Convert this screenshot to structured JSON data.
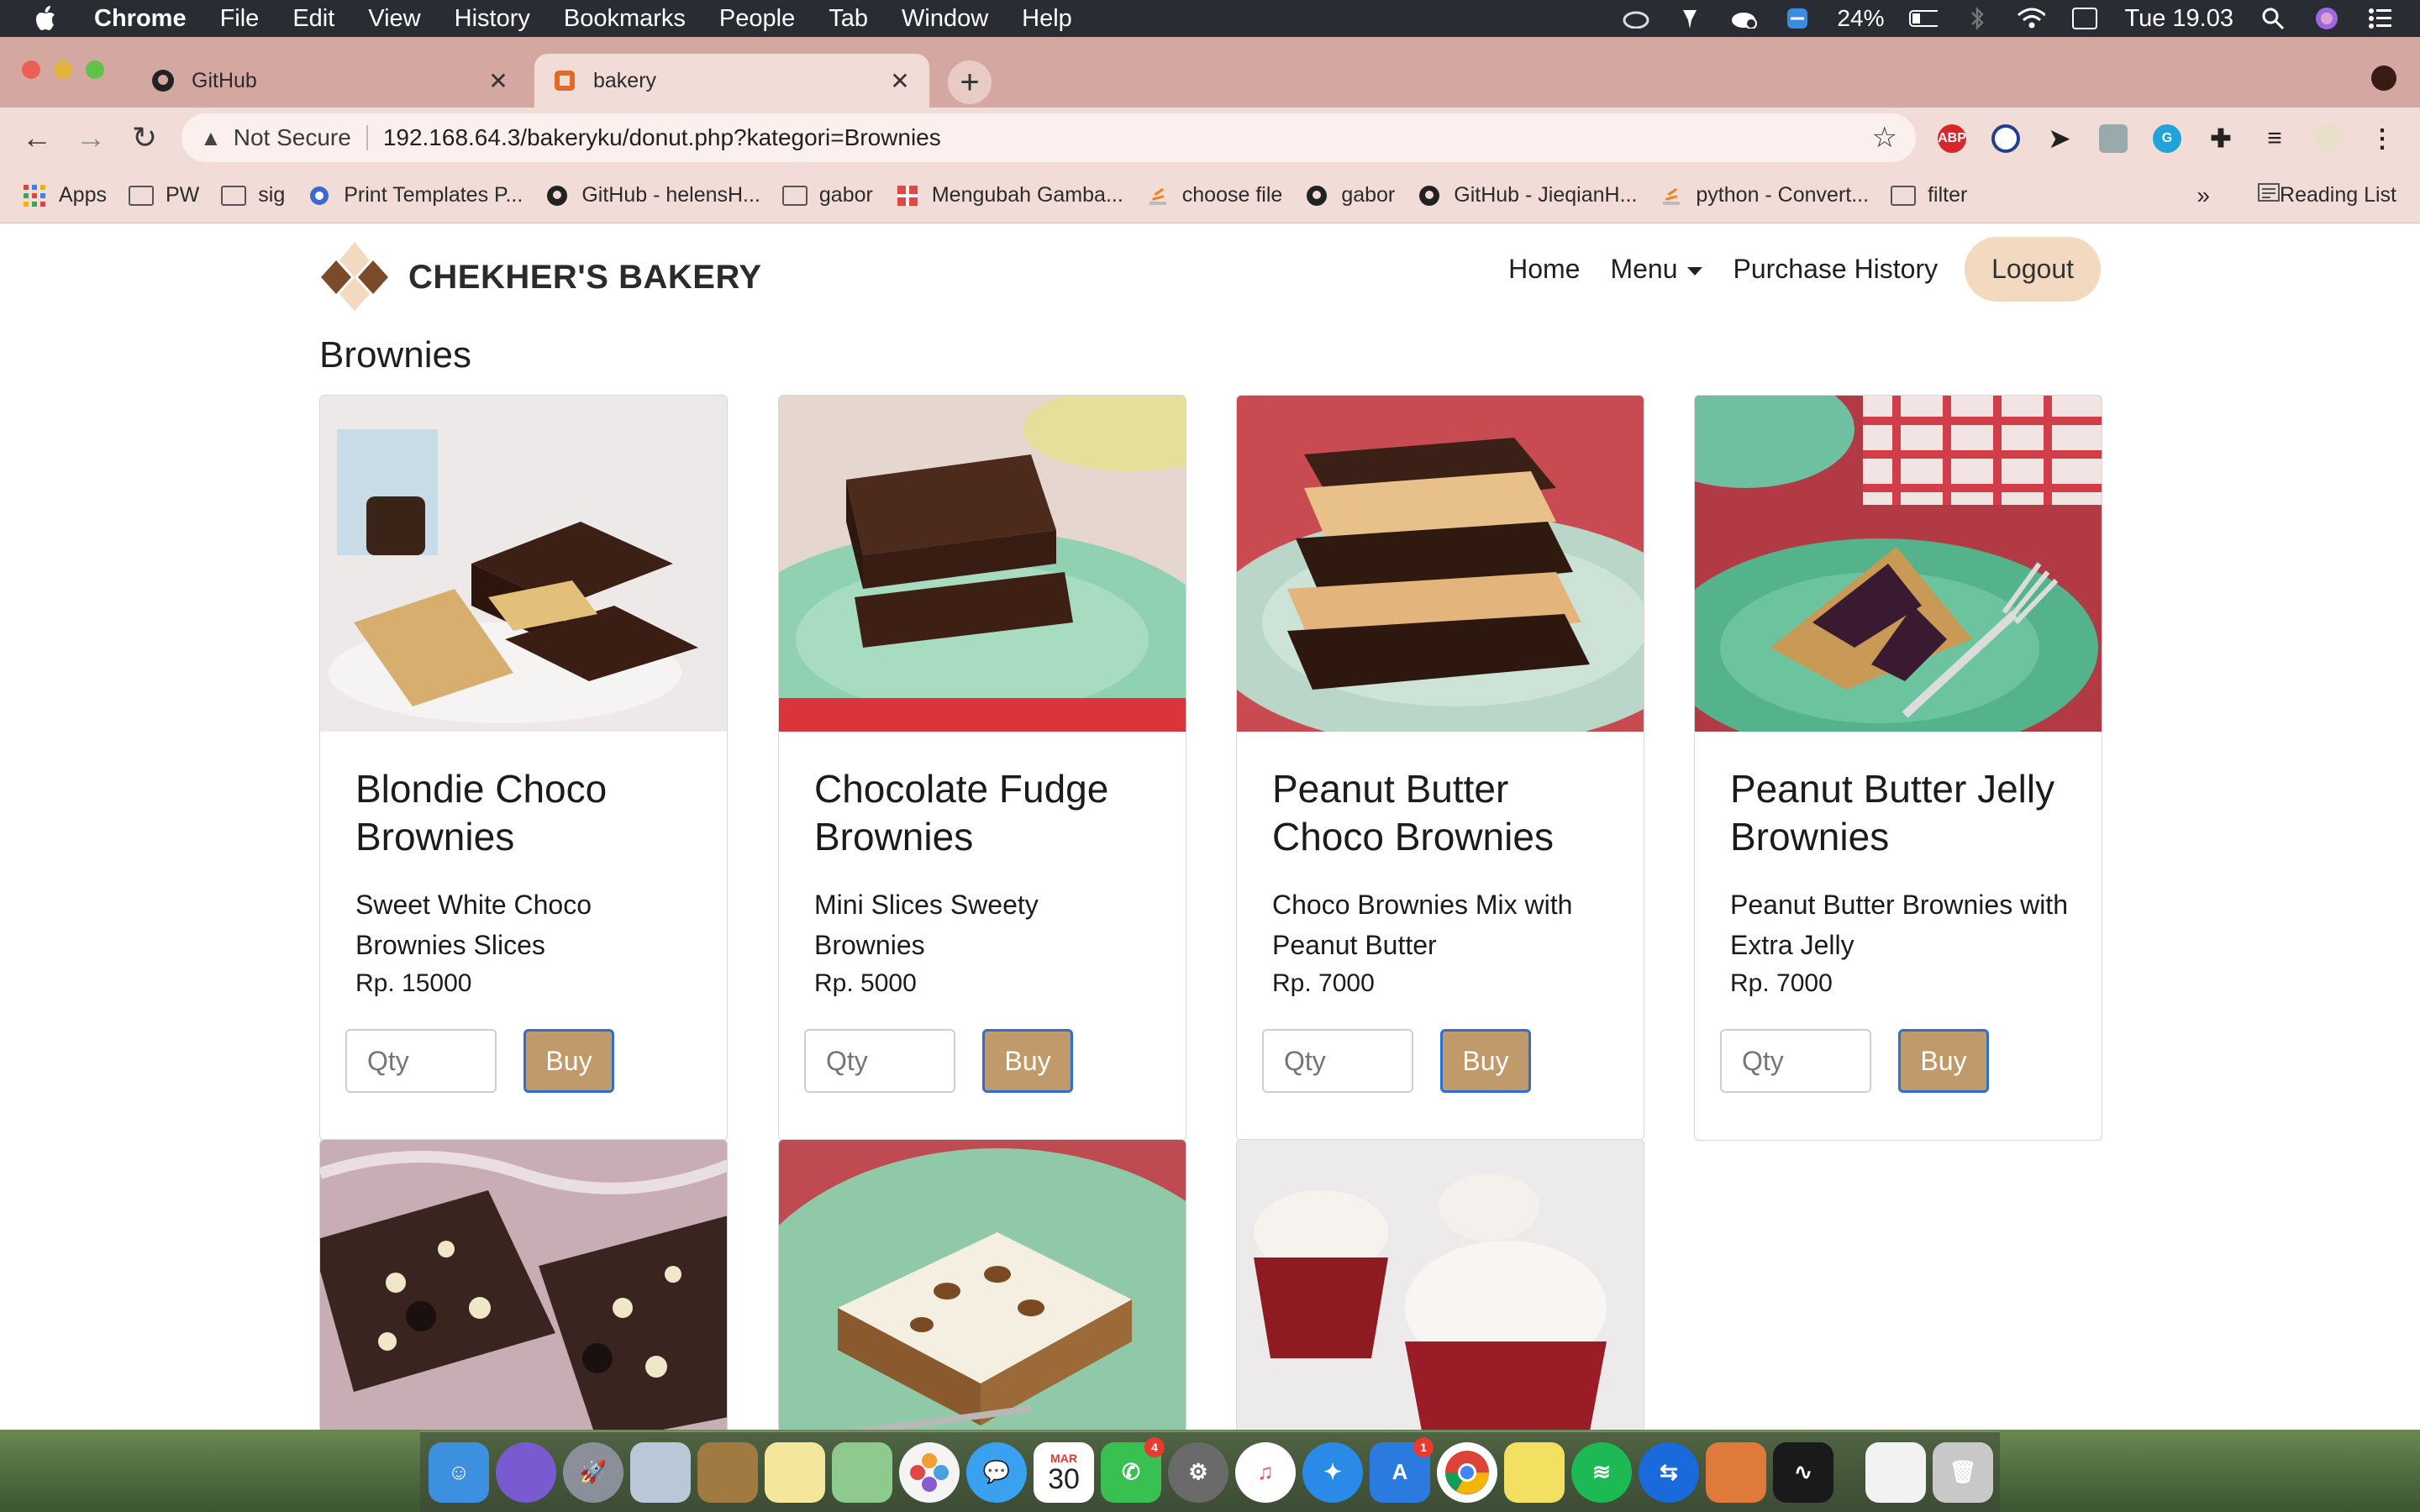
{
  "menubar": {
    "app_name": "Chrome",
    "items": [
      "File",
      "Edit",
      "View",
      "History",
      "Bookmarks",
      "People",
      "Tab",
      "Window",
      "Help"
    ],
    "battery": "24%",
    "clock": "Tue 19.03"
  },
  "tabs": [
    {
      "title": "GitHub",
      "icon": "github-icon"
    },
    {
      "title": "bakery",
      "icon": "bakery-favicon"
    }
  ],
  "omnibox": {
    "security": "Not Secure",
    "url": "192.168.64.3/bakeryku/donut.php?kategori=Brownies"
  },
  "bookmarks": [
    {
      "label": "Apps",
      "icon": "apps-grid-icon"
    },
    {
      "label": "PW",
      "icon": "folder-icon"
    },
    {
      "label": "sig",
      "icon": "folder-icon"
    },
    {
      "label": "Print Templates P...",
      "icon": "template-icon"
    },
    {
      "label": "GitHub - helensH...",
      "icon": "github-icon"
    },
    {
      "label": "gabor",
      "icon": "folder-icon"
    },
    {
      "label": "Mengubah Gamba...",
      "icon": "image-tool-icon"
    },
    {
      "label": "choose file",
      "icon": "stackoverflow-icon"
    },
    {
      "label": "gabor",
      "icon": "github-icon"
    },
    {
      "label": "GitHub - JieqianH...",
      "icon": "github-icon"
    },
    {
      "label": "python - Convert...",
      "icon": "stackoverflow-icon"
    },
    {
      "label": "filter",
      "icon": "folder-icon"
    }
  ],
  "bookmarks_more": "»",
  "reading_list": "Reading List",
  "site": {
    "brand": "CHEKHER'S BAKERY",
    "nav": {
      "home": "Home",
      "menu": "Menu",
      "history": "Purchase History",
      "logout": "Logout"
    },
    "heading": "Brownies"
  },
  "products": [
    {
      "name": "Blondie Choco Brownies",
      "desc": "Sweet White Choco Brownies Slices",
      "price": "Rp. 15000",
      "qty_placeholder": "Qty",
      "buy": "Buy"
    },
    {
      "name": "Chocolate Fudge Brownies",
      "desc": "Mini Slices Sweety Brownies",
      "price": "Rp. 5000",
      "qty_placeholder": "Qty",
      "buy": "Buy"
    },
    {
      "name": "Peanut Butter Choco Brownies",
      "desc": "Choco Brownies Mix with Peanut Butter",
      "price": "Rp. 7000",
      "qty_placeholder": "Qty",
      "buy": "Buy"
    },
    {
      "name": "Peanut Butter Jelly Brownies",
      "desc": "Peanut Butter Brownies with Extra Jelly",
      "price": "Rp. 7000",
      "qty_placeholder": "Qty",
      "buy": "Buy"
    }
  ],
  "dock": {
    "calendar_month": "MAR",
    "calendar_day": "30",
    "facetime_badge": "4",
    "appstore_badge": "1"
  },
  "colors": {
    "tab_strip": "#d4a8a0",
    "toolbar": "#f2dcd7",
    "buy_button": "#c19a6b",
    "logout_button": "#f3d9c0"
  }
}
